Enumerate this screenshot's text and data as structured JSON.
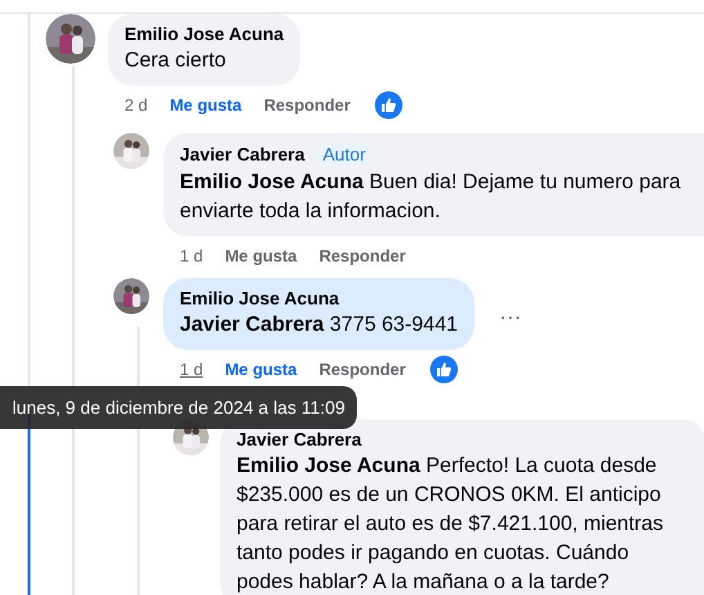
{
  "comments": [
    {
      "author": "Emilio Jose Acuna",
      "body": "Cera cierto",
      "time": "2 d",
      "hovered": false,
      "like": "Me gusta",
      "liked": true,
      "reply": "Responder",
      "reacted": true,
      "highlighted": false,
      "children": [
        {
          "author": "Javier Cabrera",
          "badge": "Autor",
          "body": "**Emilio Jose Acuna** Buen dia! Dejame tu numero para enviarte toda la informacion.",
          "time": "1 d",
          "hovered": false,
          "like": "Me gusta",
          "liked": false,
          "reply": "Responder",
          "reacted": false,
          "highlighted": false
        },
        {
          "author": "Emilio Jose Acuna",
          "body": "**Javier Cabrera** 3775 63-9441",
          "more": "···",
          "time": "1 d",
          "hovered": true,
          "like": "Me gusta",
          "liked": true,
          "reply": "Responder",
          "reacted": true,
          "highlighted": true,
          "children": [
            {
              "author": "Javier Cabrera",
              "body": "**Emilio Jose Acuna** Perfecto! La cuota desde $235.000 es de un CRONOS 0KM. El anticipo para retirar el auto es de $7.421.100, mientras tanto podes ir pagando en cuotas. Cuándo podes hablar? A la mañana o a la tarde?",
              "highlighted": false
            }
          ]
        }
      ]
    }
  ],
  "tooltip": "lunes, 9 de diciembre de 2024 a las 11:09"
}
